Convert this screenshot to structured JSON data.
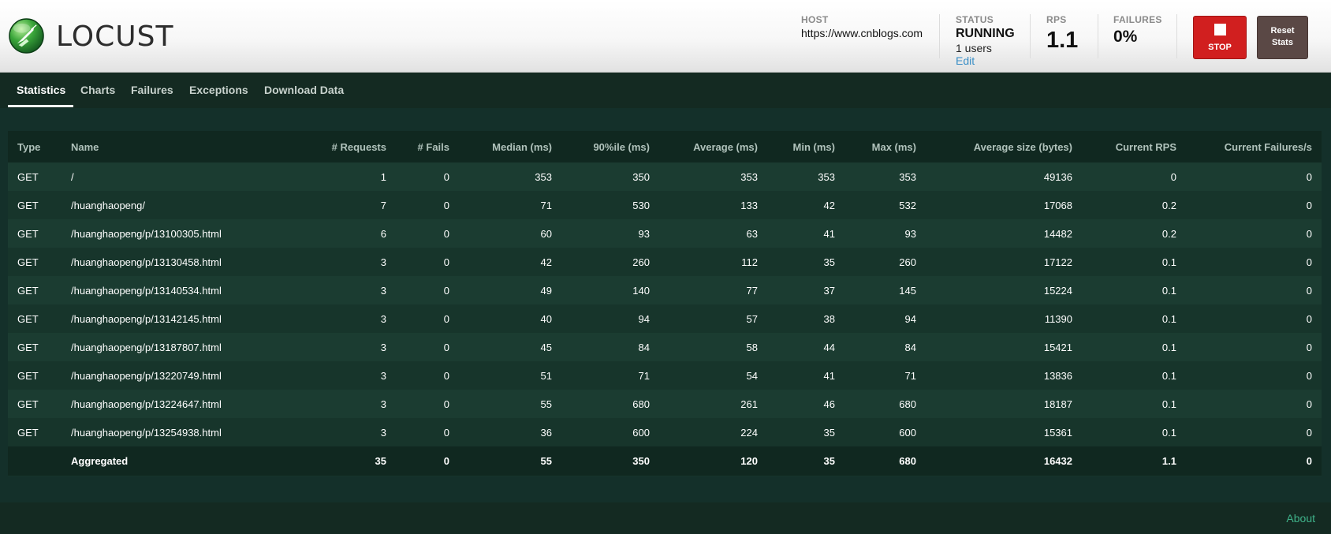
{
  "app": {
    "title": "LOCUST"
  },
  "header": {
    "host_label": "HOST",
    "host_value": "https://www.cnblogs.com",
    "status_label": "STATUS",
    "status_value": "RUNNING",
    "users_text": "1 users",
    "edit_label": "Edit",
    "rps_label": "RPS",
    "rps_value": "1.1",
    "failures_label": "FAILURES",
    "failures_value": "0%",
    "stop_label": "STOP",
    "reset_label_line1": "Reset",
    "reset_label_line2": "Stats"
  },
  "nav": {
    "tabs": [
      {
        "label": "Statistics"
      },
      {
        "label": "Charts"
      },
      {
        "label": "Failures"
      },
      {
        "label": "Exceptions"
      },
      {
        "label": "Download Data"
      }
    ],
    "active": "Statistics"
  },
  "table": {
    "columns": [
      "Type",
      "Name",
      "# Requests",
      "# Fails",
      "Median (ms)",
      "90%ile (ms)",
      "Average (ms)",
      "Min (ms)",
      "Max (ms)",
      "Average size (bytes)",
      "Current RPS",
      "Current Failures/s"
    ],
    "rows": [
      [
        "GET",
        "/",
        "1",
        "0",
        "353",
        "350",
        "353",
        "353",
        "353",
        "49136",
        "0",
        "0"
      ],
      [
        "GET",
        "/huanghaopeng/",
        "7",
        "0",
        "71",
        "530",
        "133",
        "42",
        "532",
        "17068",
        "0.2",
        "0"
      ],
      [
        "GET",
        "/huanghaopeng/p/13100305.html",
        "6",
        "0",
        "60",
        "93",
        "63",
        "41",
        "93",
        "14482",
        "0.2",
        "0"
      ],
      [
        "GET",
        "/huanghaopeng/p/13130458.html",
        "3",
        "0",
        "42",
        "260",
        "112",
        "35",
        "260",
        "17122",
        "0.1",
        "0"
      ],
      [
        "GET",
        "/huanghaopeng/p/13140534.html",
        "3",
        "0",
        "49",
        "140",
        "77",
        "37",
        "145",
        "15224",
        "0.1",
        "0"
      ],
      [
        "GET",
        "/huanghaopeng/p/13142145.html",
        "3",
        "0",
        "40",
        "94",
        "57",
        "38",
        "94",
        "11390",
        "0.1",
        "0"
      ],
      [
        "GET",
        "/huanghaopeng/p/13187807.html",
        "3",
        "0",
        "45",
        "84",
        "58",
        "44",
        "84",
        "15421",
        "0.1",
        "0"
      ],
      [
        "GET",
        "/huanghaopeng/p/13220749.html",
        "3",
        "0",
        "51",
        "71",
        "54",
        "41",
        "71",
        "13836",
        "0.1",
        "0"
      ],
      [
        "GET",
        "/huanghaopeng/p/13224647.html",
        "3",
        "0",
        "55",
        "680",
        "261",
        "46",
        "680",
        "18187",
        "0.1",
        "0"
      ],
      [
        "GET",
        "/huanghaopeng/p/13254938.html",
        "3",
        "0",
        "36",
        "600",
        "224",
        "35",
        "600",
        "15361",
        "0.1",
        "0"
      ]
    ],
    "aggregated": [
      "",
      "Aggregated",
      "35",
      "0",
      "55",
      "350",
      "120",
      "35",
      "680",
      "16432",
      "1.1",
      "0"
    ]
  },
  "footer": {
    "about_label": "About"
  },
  "colors": {
    "header_bg": "#f4f4f4",
    "body_bg": "#14302a",
    "stop_button": "#d11f1f",
    "reset_button": "#5a4845",
    "edit_link": "#3b8fc6",
    "about_link": "#3fb28a"
  },
  "icons": [
    "locust-logo-icon",
    "stop-square-icon"
  ]
}
